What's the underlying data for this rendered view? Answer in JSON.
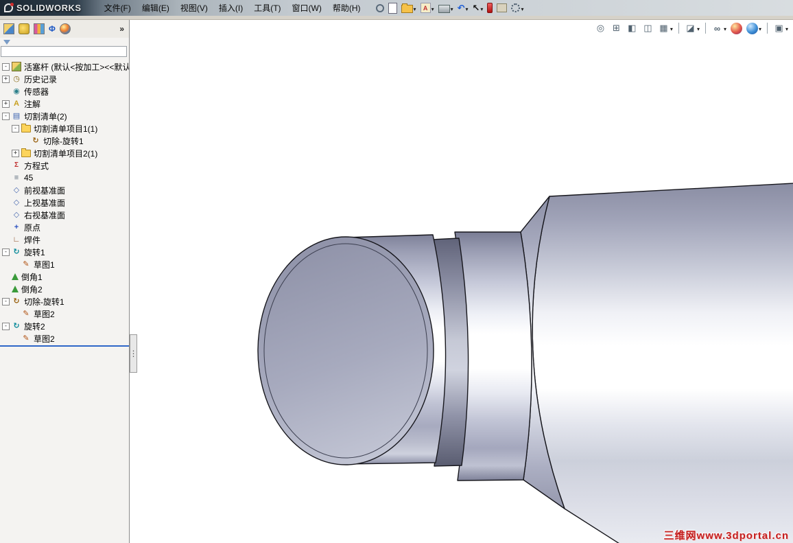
{
  "titlebar": {
    "brand": "SOLIDWORKS"
  },
  "menubar": {
    "items": [
      "文件(F)",
      "编辑(E)",
      "视图(V)",
      "插入(I)",
      "工具(T)",
      "窗口(W)",
      "帮助(H)"
    ]
  },
  "main_toolbar": {
    "icons": [
      {
        "name": "pin-icon",
        "caret": false
      },
      {
        "name": "new-document-icon",
        "caret": false
      },
      {
        "name": "open-icon",
        "caret": true
      },
      {
        "name": "make-drawing-icon",
        "caret": true
      },
      {
        "name": "print-icon",
        "caret": true
      },
      {
        "name": "undo-icon",
        "caret": true
      },
      {
        "name": "select-icon",
        "caret": true
      },
      {
        "name": "record-macro-icon",
        "caret": false
      },
      {
        "name": "toolbox-icon",
        "caret": false
      },
      {
        "name": "options-gear-icon",
        "caret": true
      }
    ]
  },
  "panel_tabs": {
    "icons": [
      "featuremanager-tab-icon",
      "propertymanager-tab-icon",
      "configurationmanager-tab-icon",
      "dimxpert-tab-icon",
      "displaymanager-tab-icon"
    ],
    "overflow": "»"
  },
  "filter": {
    "value": ""
  },
  "feature_tree": {
    "items": [
      {
        "label": "活塞杆 (默认<按加工><<默认",
        "icon": "part-icon",
        "level": 0,
        "expander": "-"
      },
      {
        "label": "历史记录",
        "icon": "history-icon",
        "level": 0,
        "expander": "+"
      },
      {
        "label": "传感器",
        "icon": "sensors-icon",
        "level": 0,
        "expander": ""
      },
      {
        "label": "注解",
        "icon": "annotations-icon",
        "level": 0,
        "expander": "+"
      },
      {
        "label": "切割清单(2)",
        "icon": "cutlist-icon",
        "level": 0,
        "expander": "-"
      },
      {
        "label": "切割清单项目1(1)",
        "icon": "folder-icon",
        "level": 1,
        "expander": "-"
      },
      {
        "label": "切除-旋转1",
        "icon": "cut-revolve-icon",
        "level": 2,
        "expander": ""
      },
      {
        "label": "切割清单项目2(1)",
        "icon": "folder-icon",
        "level": 1,
        "expander": "+"
      },
      {
        "label": "方程式",
        "icon": "equations-icon",
        "level": 0,
        "expander": ""
      },
      {
        "label": "45",
        "icon": "material-icon",
        "level": 0,
        "expander": ""
      },
      {
        "label": "前视基准面",
        "icon": "plane-icon",
        "level": 0,
        "expander": ""
      },
      {
        "label": "上视基准面",
        "icon": "plane-icon",
        "level": 0,
        "expander": ""
      },
      {
        "label": "右视基准面",
        "icon": "plane-icon",
        "level": 0,
        "expander": ""
      },
      {
        "label": "原点",
        "icon": "origin-icon",
        "level": 0,
        "expander": ""
      },
      {
        "label": "焊件",
        "icon": "weldment-icon",
        "level": 0,
        "expander": ""
      },
      {
        "label": "旋转1",
        "icon": "revolve-icon",
        "level": 0,
        "expander": "-"
      },
      {
        "label": "草图1",
        "icon": "sketch-icon",
        "level": 1,
        "expander": ""
      },
      {
        "label": "倒角1",
        "icon": "chamfer-icon",
        "level": 0,
        "expander": ""
      },
      {
        "label": "倒角2",
        "icon": "chamfer-icon",
        "level": 0,
        "expander": ""
      },
      {
        "label": "切除-旋转1",
        "icon": "cut-revolve-icon",
        "level": 0,
        "expander": "-"
      },
      {
        "label": "草图2",
        "icon": "sketch-icon",
        "level": 1,
        "expander": ""
      },
      {
        "label": "旋转2",
        "icon": "revolve-icon",
        "level": 0,
        "expander": "-"
      },
      {
        "label": "草图2",
        "icon": "sketch-icon",
        "level": 1,
        "expander": ""
      }
    ]
  },
  "heads_up_toolbar": {
    "icons": [
      {
        "name": "zoom-fit-icon"
      },
      {
        "name": "zoom-area-icon"
      },
      {
        "name": "section-view-icon"
      },
      {
        "name": "view-orientation-icon"
      },
      {
        "name": "standard-views-icon",
        "caret": true
      },
      {
        "type": "sep"
      },
      {
        "name": "display-style-icon",
        "caret": true
      },
      {
        "type": "sep"
      },
      {
        "name": "hide-show-items-icon",
        "caret": true
      },
      {
        "name": "edit-appearance-icon"
      },
      {
        "name": "apply-scene-icon",
        "caret": true
      },
      {
        "type": "sep"
      },
      {
        "name": "view-settings-icon",
        "caret": true
      }
    ]
  },
  "viewport": {
    "watermark": "三维网www.3dportal.cn"
  },
  "colors": {
    "rollback_blue": "#2e66c8",
    "watermark_red": "#c42020",
    "viewport_bg": "#ffffff"
  }
}
